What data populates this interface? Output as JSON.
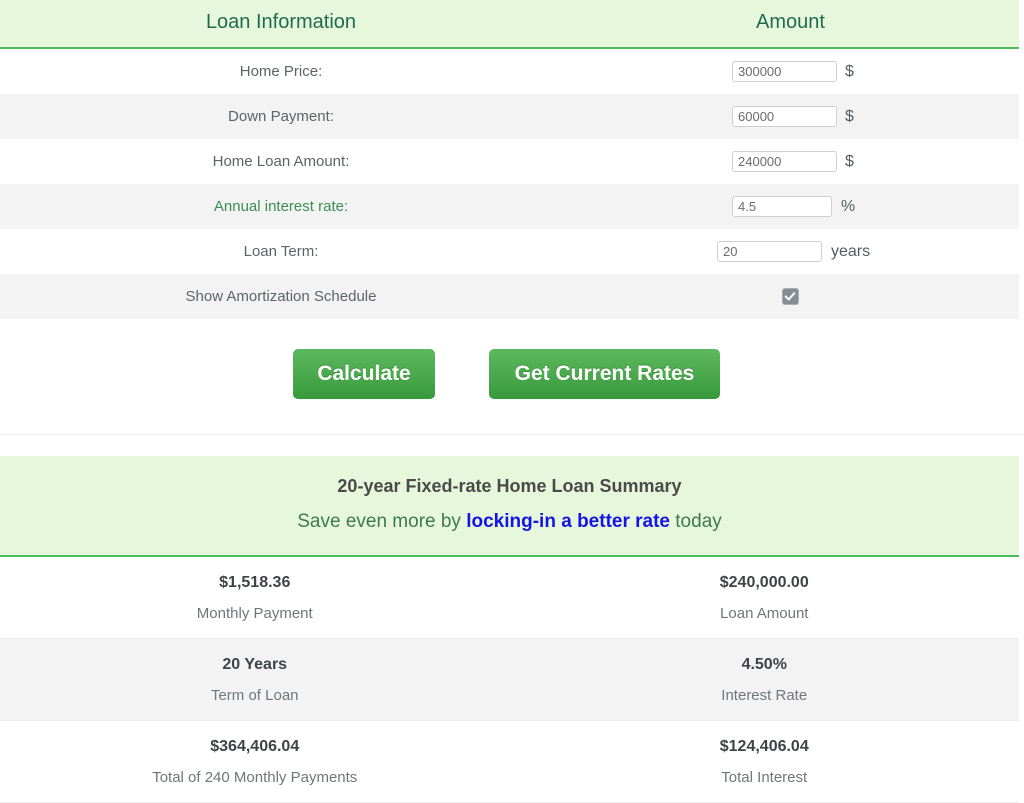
{
  "calculator": {
    "headers": {
      "label_column": "Loan Information",
      "amount_column": "Amount"
    },
    "rows": [
      {
        "label": "Home Price:",
        "value": "300000",
        "unit": "$",
        "kind": "input"
      },
      {
        "label": "Down Payment:",
        "value": "60000",
        "unit": "$",
        "kind": "input"
      },
      {
        "label": "Home Loan Amount:",
        "value": "240000",
        "unit": "$",
        "kind": "input"
      },
      {
        "label": "Annual interest rate:",
        "value": "4.5",
        "unit": "%",
        "kind": "input"
      },
      {
        "label": "Loan Term:",
        "value": "20",
        "unit": "years",
        "kind": "input"
      },
      {
        "label": "Show Amortization Schedule",
        "value": "checked",
        "unit": "",
        "kind": "checkbox"
      }
    ]
  },
  "actions": {
    "calculate_label": "Calculate",
    "get_rates_label": "Get Current Rates"
  },
  "summary": {
    "title": "20-year Fixed-rate Home Loan Summary",
    "subtitle_before": "Save even more by ",
    "subtitle_link": "locking-in a better rate",
    "subtitle_after": " today",
    "rows": [
      {
        "left_value": "$1,518.36",
        "left_label": "Monthly Payment",
        "right_value": "$240,000.00",
        "right_label": "Loan Amount"
      },
      {
        "left_value": "20 Years",
        "left_label": "Term of Loan",
        "right_value": "4.50%",
        "right_label": "Interest Rate"
      },
      {
        "left_value": "$364,406.04",
        "left_label": "Total of 240 Monthly Payments",
        "right_value": "$124,406.04",
        "right_label": "Total Interest"
      }
    ]
  },
  "colors": {
    "header_band": "#e7f7dc",
    "header_text": "#1f6b4e",
    "accent_green": "#4cbb5a",
    "button_green": "#4aa84c",
    "link_blue": "#1414e6",
    "row_alt": "#f3f3f3"
  }
}
